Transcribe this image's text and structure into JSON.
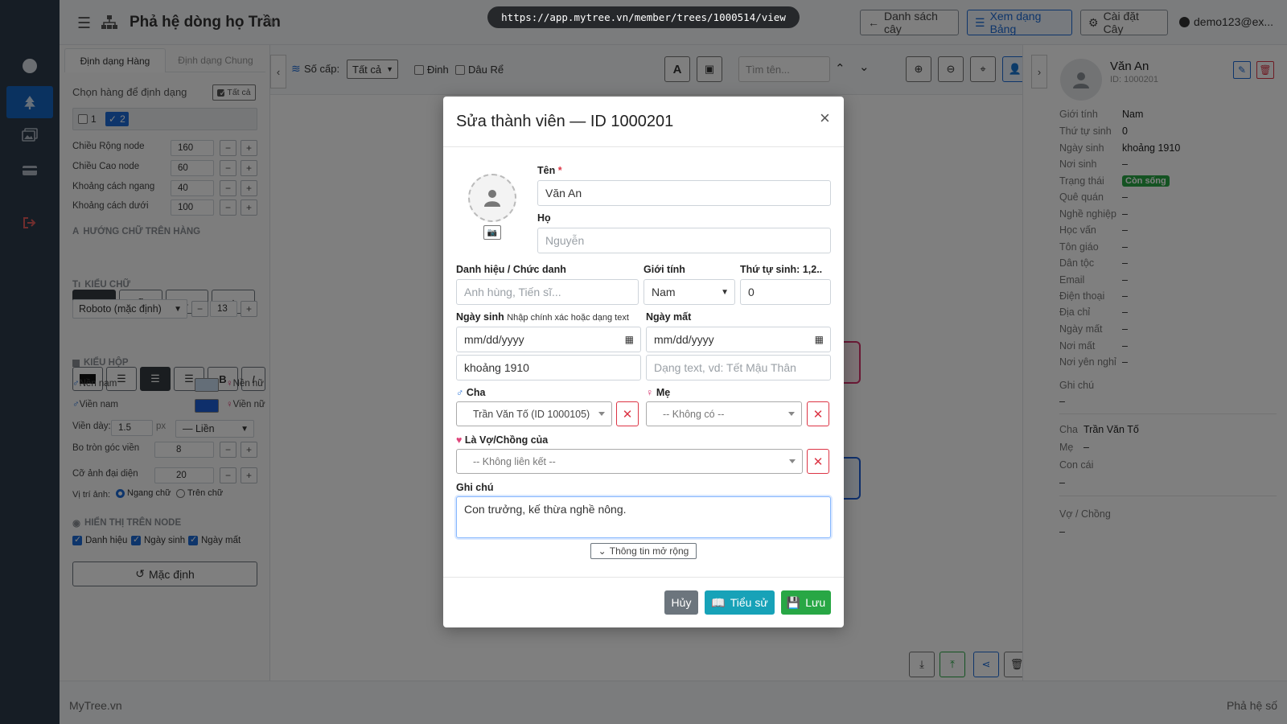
{
  "url": "https://app.mytree.vn/member/trees/1000514/view",
  "header": {
    "title": "Phả hệ dòng họ Trần",
    "btn_list": "Danh sách cây",
    "btn_table": "Xem dạng Bảng",
    "btn_settings": "Cài đặt Cây",
    "user": "demo123@ex..."
  },
  "left_panel": {
    "tab_row": "Định dạng Hàng",
    "tab_common": "Định dạng Chung",
    "choose_rows": "Chọn hàng để định dạng",
    "all_btn": "Tất cả",
    "row1": "1",
    "row2": "2",
    "node_width_label": "Chiều Rộng node",
    "node_width": "160",
    "node_height_label": "Chiều Cao node",
    "node_height": "60",
    "h_gap_label": "Khoảng cách ngang",
    "h_gap": "40",
    "v_gap_label": "Khoảng cách dưới",
    "v_gap": "100",
    "text_dir_title": "HƯỚNG CHỮ TRÊN HÀNG",
    "font_title": "KIỂU CHỮ",
    "font_family": "Roboto (mặc định)",
    "font_size": "13",
    "bold": "B",
    "italic": "I",
    "box_title": "KIỂU HỘP",
    "bg_male": "Nền nam",
    "bg_female": "Nền nữ",
    "border_male": "Viền nam",
    "border_female": "Viền nữ",
    "border_width_label": "Viền dày:",
    "border_width": "1.5",
    "px": "px",
    "border_style": "— Liền",
    "radius_label": "Bo tròn góc viền",
    "radius": "8",
    "avatar_size_label": "Cỡ ảnh đại diện",
    "avatar_size": "20",
    "img_pos_label": "Vị trí ảnh:",
    "img_pos_side": "Ngang chữ",
    "img_pos_top": "Trên chữ",
    "show_title": "HIỂN THỊ TRÊN NODE",
    "show_title_opt": "Danh hiệu",
    "show_birth_opt": "Ngày sinh",
    "show_death_opt": "Ngày mất",
    "reset_btn": "Mặc định"
  },
  "toolbar": {
    "levels_label": "Số cấp:",
    "levels_value": "Tất cả",
    "pin": "Đinh",
    "son_in_law": "Dâu Rể",
    "search_placeholder": "Tìm tên..."
  },
  "right_panel": {
    "name": "Văn An",
    "id": "ID: 1000201",
    "rows": [
      {
        "label": "Giới tính",
        "value": "Nam"
      },
      {
        "label": "Thứ tự sinh",
        "value": "0"
      },
      {
        "label": "Ngày sinh",
        "value": "khoảng 1910"
      },
      {
        "label": "Nơi sinh",
        "value": "–"
      },
      {
        "label": "Trạng thái",
        "value": "Còn sống"
      },
      {
        "label": "Quê quán",
        "value": "–"
      },
      {
        "label": "Nghề nghiệp",
        "value": "–"
      },
      {
        "label": "Học vấn",
        "value": "–"
      },
      {
        "label": "Tôn giáo",
        "value": "–"
      },
      {
        "label": "Dân tộc",
        "value": "–"
      },
      {
        "label": "Email",
        "value": "–"
      },
      {
        "label": "Điện thoại",
        "value": "–"
      },
      {
        "label": "Địa chỉ",
        "value": "–"
      },
      {
        "label": "Ngày mất",
        "value": "–"
      },
      {
        "label": "Nơi mất",
        "value": "–"
      },
      {
        "label": "Nơi yên nghỉ",
        "value": "–"
      }
    ],
    "note_label": "Ghi chú",
    "note_value": "–",
    "father_label": "Cha",
    "father_value": "Trần Văn Tố",
    "mother_label": "Mẹ",
    "mother_value": "–",
    "children_label": "Con cái",
    "children_value": "–",
    "spouse_label": "Vợ / Chồng",
    "spouse_value": "–"
  },
  "footer": {
    "brand": "MyTree.vn",
    "right": "Phả hệ số"
  },
  "modal": {
    "title": "Sửa thành viên — ID 1000201",
    "first_name_label": "Tên",
    "required": "*",
    "first_name": "Văn An",
    "last_name_label": "Họ",
    "last_name_placeholder": "Nguyễn",
    "honorific_label": "Danh hiệu / Chức danh",
    "honorific_placeholder": "Anh hùng, Tiến sĩ...",
    "gender_label": "Giới tính",
    "gender_value": "Nam",
    "birth_order_label": "Thứ tự sinh: 1,2..",
    "birth_order": "0",
    "birth_label": "Ngày sinh",
    "birth_hint": "Nhập chính xác hoặc dạng text",
    "date_placeholder": "mm/dd/yyyy",
    "death_label": "Ngày mất",
    "birth_text": "khoảng 1910",
    "death_text_placeholder": "Dạng text, vd: Tết Mậu Thân",
    "father_label": "Cha",
    "father_value": "Trần Văn Tố (ID 1000105)",
    "mother_label": "Mẹ",
    "mother_value": "-- Không có --",
    "spouse_label": "Là Vợ/Chồng của",
    "spouse_value": "-- Không liên kết --",
    "note_label": "Ghi chú",
    "note_value": "Con trưởng, kế thừa nghề nông.",
    "extended_btn": "Thông tin mở rộng",
    "cancel_btn": "Hủy",
    "bio_btn": "Tiểu sử",
    "save_btn": "Lưu"
  },
  "colors": {
    "primary": "#1c6bd6",
    "danger": "#dc3545",
    "success": "#28a745",
    "info": "#17a2b8",
    "rail": "#2d3a4b",
    "bg_male_swatch": "#c9dcf0",
    "bg_female_swatch": "#f7d4dc",
    "border_male_swatch": "#1c5fd6",
    "border_female_swatch": "#d6336c"
  }
}
